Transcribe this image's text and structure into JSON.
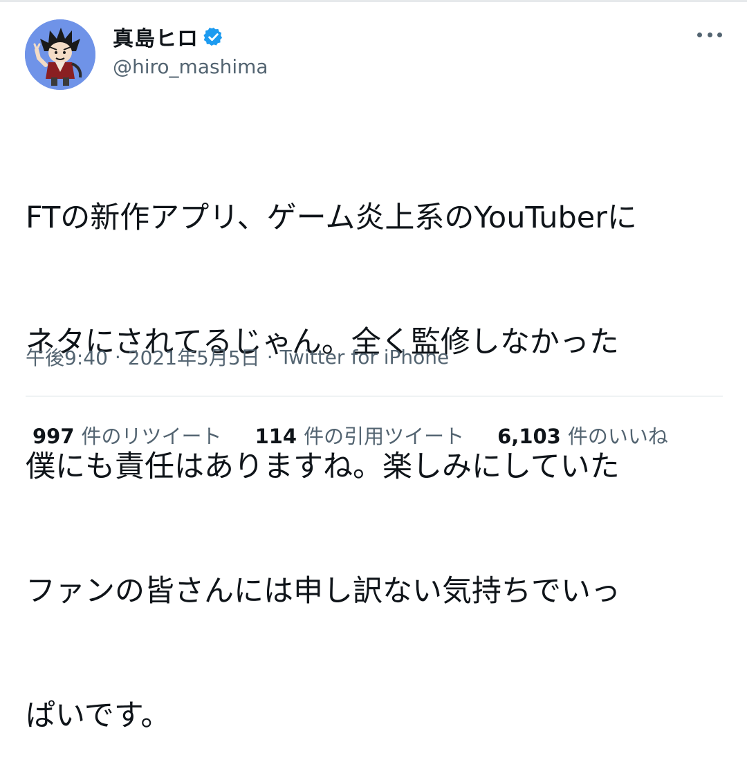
{
  "author": {
    "display_name": "真島ヒロ",
    "handle": "@hiro_mashima",
    "verified": true,
    "avatar_icon": "user-avatar-icon"
  },
  "tweet": {
    "text_lines": [
      "FTの新作アプリ、ゲーム炎上系のYouTuberに",
      "ネタにされてるじゃん。全く監修しなかった",
      "僕にも責任はありますね。楽しみにしていた",
      "ファンの皆さんには申し訳ない気持ちでいっ",
      "ぱいです。"
    ],
    "time": "午後9:40",
    "date": "2021年5月5日",
    "separator": "·",
    "source": "Twitter for iPhone"
  },
  "stats": {
    "retweets_count": "997",
    "retweets_label": "件のリツイート",
    "quotes_count": "114",
    "quotes_label": "件の引用ツイート",
    "likes_count": "6,103",
    "likes_label": "件のいいね"
  },
  "colors": {
    "text_primary": "#0f1419",
    "text_secondary": "#536471",
    "verified_badge": "#1d9bf0",
    "avatar_bg": "#6f93e8",
    "divider": "#eff3f4"
  },
  "icons": {
    "verified": "verified-badge-icon",
    "more": "more-options-icon"
  }
}
